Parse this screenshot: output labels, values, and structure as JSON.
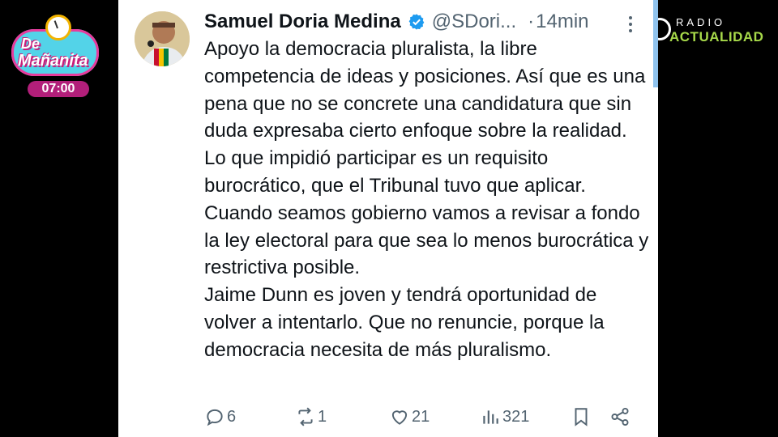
{
  "logo": {
    "line1": "De",
    "line2": "Mañanita",
    "time": "07:00"
  },
  "radio": {
    "top": "RADIO",
    "bottom": "ACTUALIDAD"
  },
  "tweet": {
    "author_name": "Samuel Doria Medina",
    "handle": "@SDori...",
    "separator": "·",
    "time_ago": "14min",
    "paragraphs": [
      "Apoyo la democracia pluralista, la libre competencia de ideas y posiciones. Así que es una pena que no se concrete una candidatura que sin duda expresaba cierto enfoque sobre la realidad.",
      "Lo que impidió participar es un requisito burocrático, que el Tribunal tuvo que aplicar.",
      "Cuando seamos gobierno vamos a revisar a fondo la ley electoral para que sea lo menos burocrática y restrictiva posible.",
      "Jaime Dunn es joven y tendrá oportunidad de volver a intentarlo. Que no renuncie, porque la democracia necesita de más pluralismo."
    ],
    "stats": {
      "replies": "6",
      "reposts": "1",
      "likes": "21",
      "views": "321"
    }
  },
  "colors": {
    "accent": "#1d9bf0",
    "muted": "#536471",
    "text": "#0f1419",
    "radio_green": "#a7d94a",
    "logo_pink": "#e83b9c",
    "logo_cyan": "#53d3e8"
  },
  "icons": [
    "verified-badge-icon",
    "more-options-icon",
    "reply-icon",
    "repost-icon",
    "like-icon",
    "views-icon",
    "bookmark-icon",
    "share-icon",
    "clock-icon"
  ]
}
